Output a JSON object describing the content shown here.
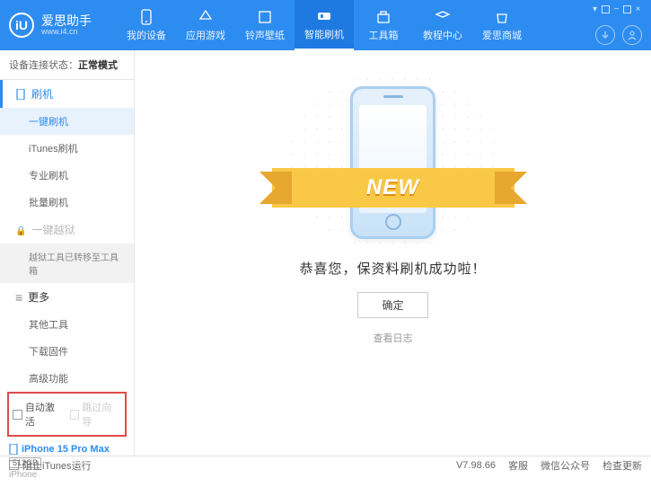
{
  "brand": {
    "name": "爱思助手",
    "url": "www.i4.cn",
    "logo_letter": "iU"
  },
  "nav": {
    "items": [
      {
        "label": "我的设备"
      },
      {
        "label": "应用游戏"
      },
      {
        "label": "铃声壁纸"
      },
      {
        "label": "智能刷机"
      },
      {
        "label": "工具箱"
      },
      {
        "label": "教程中心"
      },
      {
        "label": "爱思商城"
      }
    ],
    "active_index": 3
  },
  "status": {
    "prefix": "设备连接状态：",
    "value": "正常模式"
  },
  "sidebar": {
    "flash": {
      "label": "刷机",
      "items": [
        "一键刷机",
        "iTunes刷机",
        "专业刷机",
        "批量刷机"
      ],
      "active": 0
    },
    "jailbreak": {
      "label": "一键越狱",
      "transfer": "越狱工具已转移至工具箱"
    },
    "more": {
      "label": "更多",
      "items": [
        "其他工具",
        "下载固件",
        "高级功能"
      ]
    },
    "checks": {
      "auto_activate": "自动激活",
      "skip_guide": "跳过向导"
    }
  },
  "device": {
    "name": "iPhone 15 Pro Max",
    "storage": "512GB",
    "type": "iPhone"
  },
  "main": {
    "ribbon": "NEW",
    "success": "恭喜您，保资料刷机成功啦！",
    "ok": "确定",
    "view_log": "查看日志"
  },
  "footer": {
    "block_itunes": "阻止iTunes运行",
    "version": "V7.98.66",
    "items": [
      "客服",
      "微信公众号",
      "检查更新"
    ]
  }
}
